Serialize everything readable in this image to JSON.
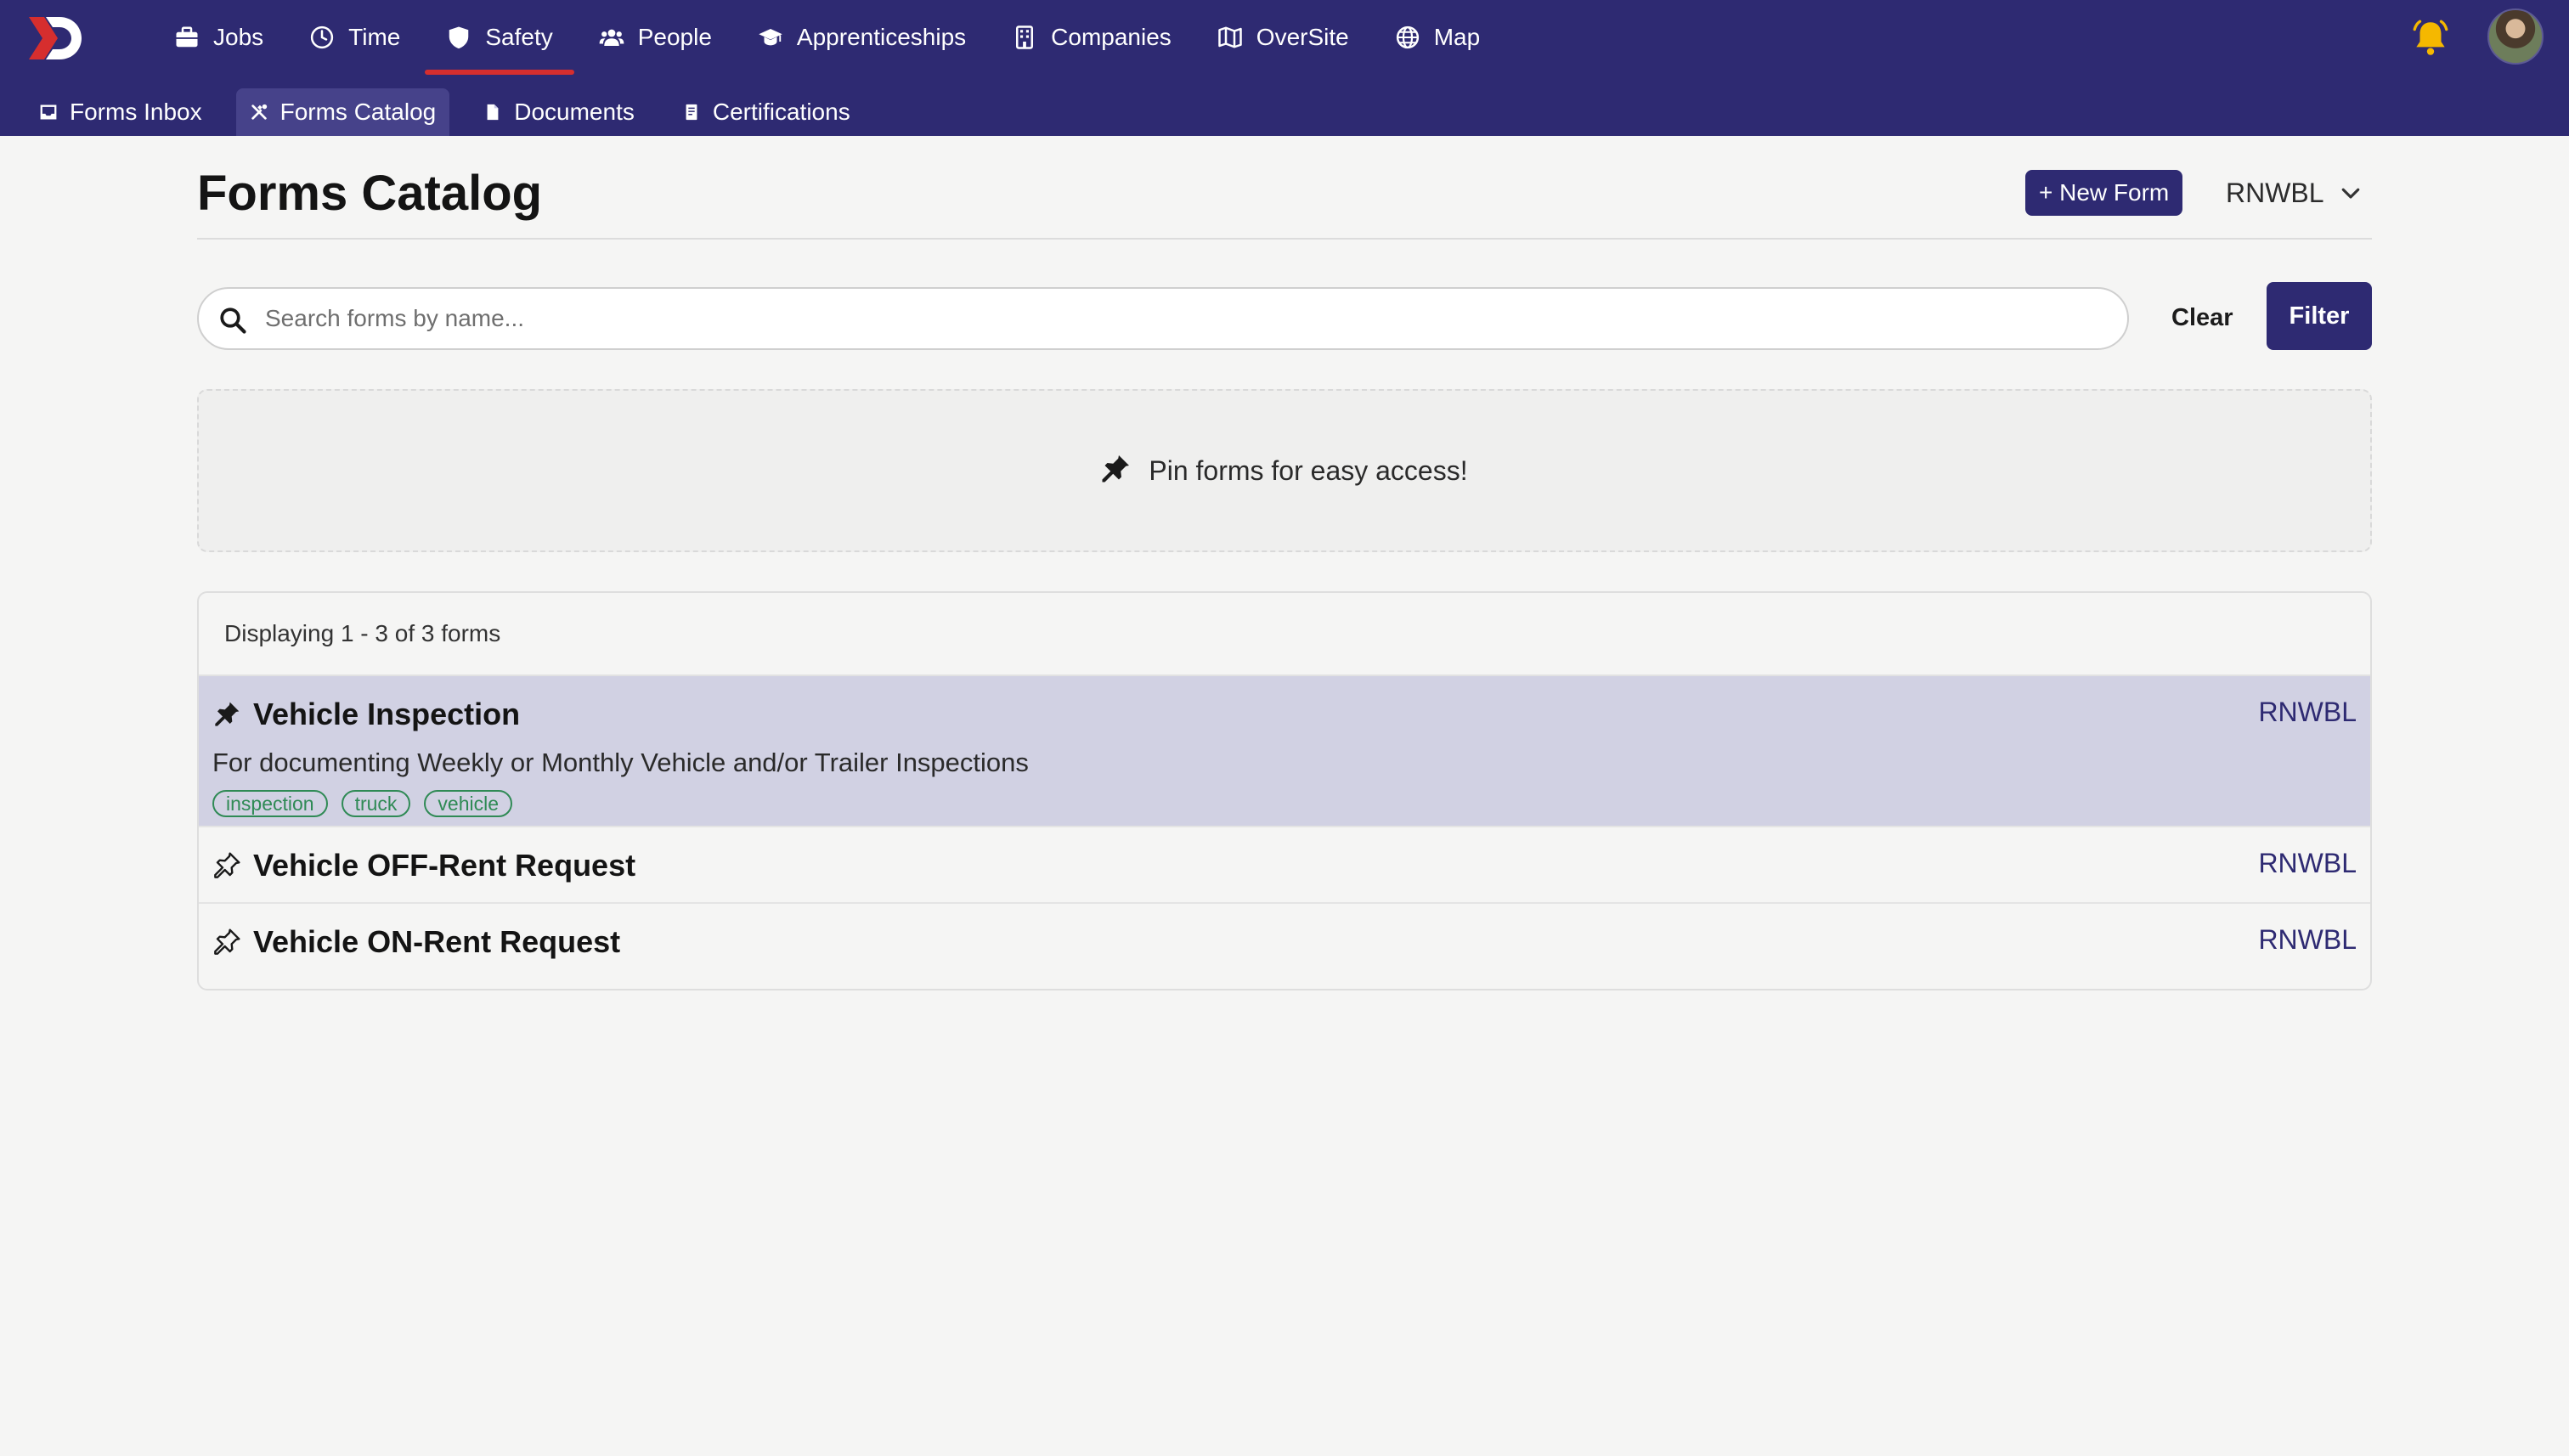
{
  "nav": {
    "items": [
      {
        "label": "Jobs",
        "icon": "briefcase-icon",
        "active": false
      },
      {
        "label": "Time",
        "icon": "clock-icon",
        "active": false
      },
      {
        "label": "Safety",
        "icon": "shield-icon",
        "active": true
      },
      {
        "label": "People",
        "icon": "people-icon",
        "active": false
      },
      {
        "label": "Apprenticeships",
        "icon": "graduation-cap-icon",
        "active": false
      },
      {
        "label": "Companies",
        "icon": "building-icon",
        "active": false
      },
      {
        "label": "OverSite",
        "icon": "map-book-icon",
        "active": false
      },
      {
        "label": "Map",
        "icon": "globe-icon",
        "active": false
      }
    ],
    "accent_color": "#d62e2e",
    "bar_color": "#2e2a72"
  },
  "subnav": {
    "items": [
      {
        "label": "Forms Inbox",
        "icon": "inbox-icon",
        "active": false
      },
      {
        "label": "Forms Catalog",
        "icon": "tools-icon",
        "active": true
      },
      {
        "label": "Documents",
        "icon": "document-icon",
        "active": false
      },
      {
        "label": "Certifications",
        "icon": "certificate-icon",
        "active": false
      }
    ]
  },
  "header": {
    "title": "Forms Catalog",
    "new_form_label": "+ New Form",
    "org_selected": "RNWBL"
  },
  "search": {
    "placeholder": "Search forms by name...",
    "value": "",
    "clear_label": "Clear",
    "filter_label": "Filter"
  },
  "pin_banner": {
    "text": "Pin forms for easy access!"
  },
  "forms": {
    "count_text": "Displaying 1 - 3 of 3 forms",
    "items": [
      {
        "name": "Vehicle Inspection",
        "org": "RNWBL",
        "description": "For documenting Weekly or Monthly Vehicle and/or Trailer Inspections",
        "tags": [
          "inspection",
          "truck",
          "vehicle"
        ],
        "pinned": true
      },
      {
        "name": "Vehicle OFF-Rent Request",
        "org": "RNWBL",
        "pinned": false
      },
      {
        "name": "Vehicle ON-Rent Request",
        "org": "RNWBL",
        "pinned": false
      }
    ],
    "tag_color": "#2f8a55",
    "highlight_color": "#d1d1e3"
  }
}
